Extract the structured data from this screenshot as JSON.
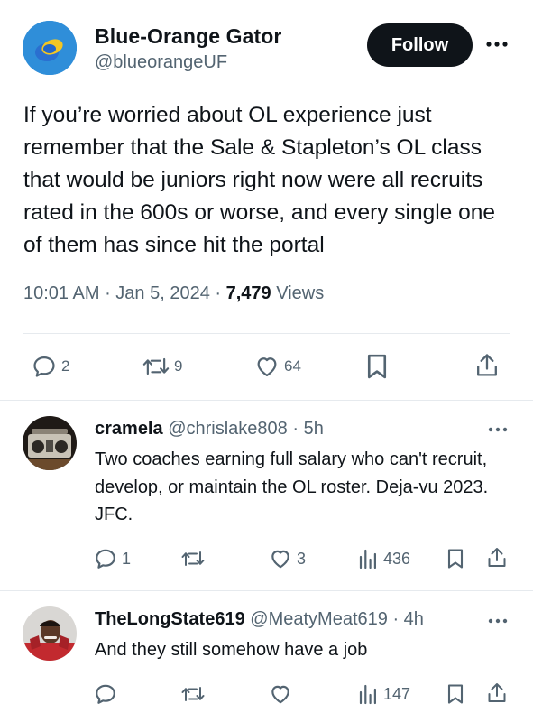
{
  "tweet": {
    "author_name": "Blue-Orange Gator",
    "author_handle": "@blueorangeUF",
    "follow_label": "Follow",
    "text": "If you’re worried about OL experience just remember that the Sale & Stapleton’s OL class that would be juniors right now were all recruits rated in the 600s or worse, and every single one of them has since hit the portal",
    "time": "10:01 AM",
    "date": "Jan 5, 2024",
    "views_count": "7,479",
    "views_label": "Views",
    "reply_count": "2",
    "retweet_count": "9",
    "like_count": "64"
  },
  "replies": [
    {
      "name": "cramela",
      "handle": "@chrislake808",
      "age": "5h",
      "text": "Two coaches earning full salary who can't recruit, develop, or maintain the OL roster. Deja-vu 2023. JFC.",
      "reply_count": "1",
      "retweet_count": "",
      "like_count": "3",
      "view_count": "436"
    },
    {
      "name": "TheLongState619",
      "handle": "@MeatyMeat619",
      "age": "4h",
      "text": "And they still somehow have a job",
      "reply_count": "",
      "retweet_count": "",
      "like_count": "",
      "view_count": "147"
    }
  ],
  "icons": {
    "reply": "speech-bubble-icon",
    "retweet": "retweet-icon",
    "like": "heart-icon",
    "bookmark": "bookmark-icon",
    "share": "share-icon",
    "views": "bar-chart-icon",
    "more": "more-horizontal-icon"
  },
  "colors": {
    "text": "#0f1419",
    "secondary": "#536471",
    "follow_bg": "#0f1419",
    "divider": "#e6eaee"
  }
}
